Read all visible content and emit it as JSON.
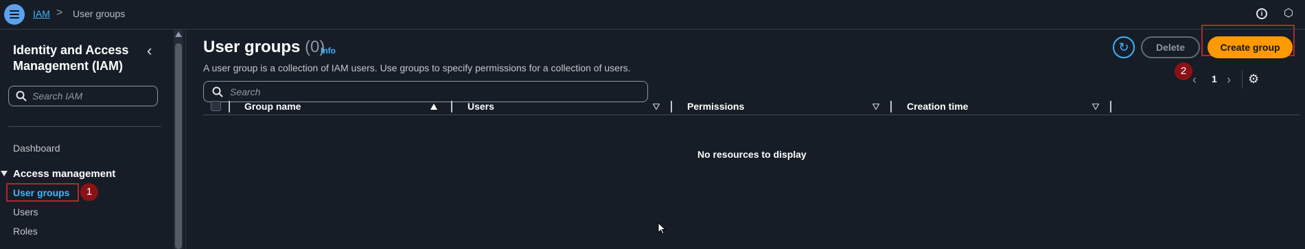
{
  "topbar": {
    "breadcrumb_root": "IAM",
    "breadcrumb_separator": ">",
    "breadcrumb_current": "User groups",
    "menu_icon": "hamburger-icon",
    "info_icon": "info-icon",
    "settings_icon": "settings-hex-icon"
  },
  "sidebar": {
    "title": "Identity and Access Management (IAM)",
    "search_placeholder": "Search IAM",
    "dashboard": "Dashboard",
    "section_title": "Access management",
    "items": [
      {
        "label": "User groups",
        "active": true
      },
      {
        "label": "Users"
      },
      {
        "label": "Roles"
      }
    ],
    "badge_1": "1"
  },
  "main": {
    "title": "User groups",
    "count": "(0)",
    "info": "Info",
    "description": "A user group is a collection of IAM users. Use groups to specify permissions for a collection of users.",
    "search_placeholder": "Search",
    "refresh_icon": "refresh-icon",
    "delete_label": "Delete",
    "create_label": "Create group",
    "badge_2": "2",
    "page_number": "1",
    "columns": [
      "Group name",
      "Users",
      "Permissions",
      "Creation time"
    ],
    "empty_message": "No resources to display"
  },
  "colors": {
    "background": "#161d26",
    "accent": "#42b4ff",
    "primary_button": "#ff9900",
    "highlight_border": "#b3282d",
    "badge": "#8a1215"
  }
}
